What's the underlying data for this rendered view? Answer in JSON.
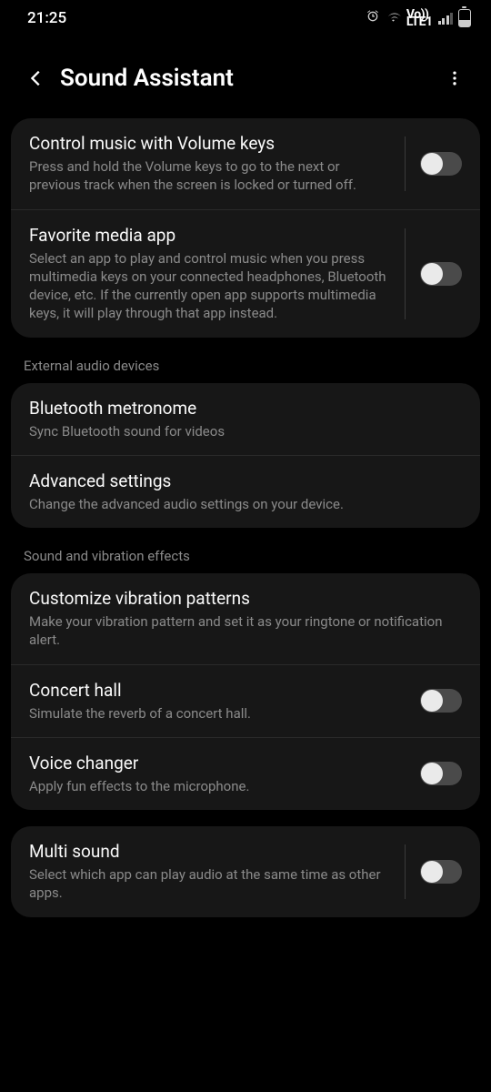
{
  "status": {
    "time": "21:25",
    "lte_top": "Vo))",
    "lte_bottom": "LTE1"
  },
  "header": {
    "title": "Sound Assistant"
  },
  "sections": {
    "s0": {
      "items": [
        {
          "title": "Control music with Volume keys",
          "desc": "Press and hold the Volume keys to go to the next or previous track when the screen is locked or turned off."
        },
        {
          "title": "Favorite media app",
          "desc": "Select an app to play and control music when you press multimedia keys on your connected headphones, Bluetooth device, etc. If the currently open app supports multimedia keys, it will play through that app instead."
        }
      ]
    },
    "s1": {
      "label": "External audio devices",
      "items": [
        {
          "title": "Bluetooth metronome",
          "desc": "Sync Bluetooth sound for videos"
        },
        {
          "title": "Advanced settings",
          "desc": "Change the advanced audio settings on your device."
        }
      ]
    },
    "s2": {
      "label": "Sound and vibration effects",
      "items": [
        {
          "title": "Customize vibration patterns",
          "desc": "Make your vibration pattern and set it as your ringtone or notification alert."
        },
        {
          "title": "Concert hall",
          "desc": "Simulate the reverb of a concert hall."
        },
        {
          "title": "Voice changer",
          "desc": "Apply fun effects to the microphone."
        }
      ]
    },
    "s3": {
      "items": [
        {
          "title": "Multi sound",
          "desc": "Select which app can play audio at the same time as other apps."
        }
      ]
    }
  }
}
